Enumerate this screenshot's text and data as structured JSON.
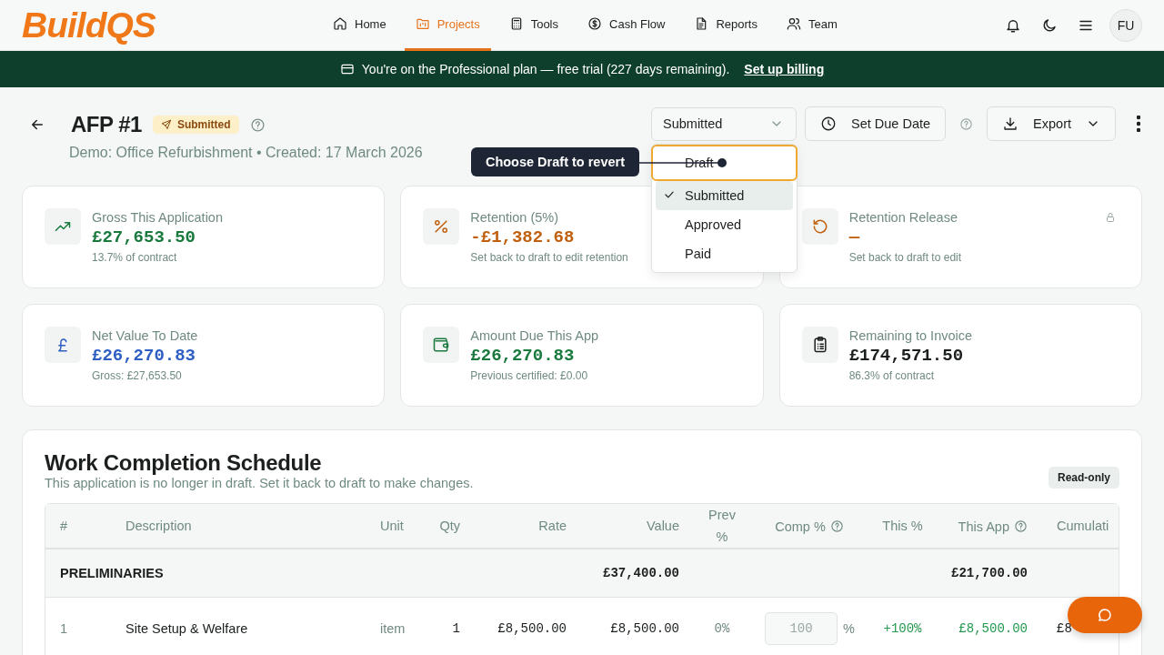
{
  "header": {
    "logo": "BuildQS",
    "nav": [
      {
        "label": "Home",
        "kind": "home",
        "selected": false
      },
      {
        "label": "Projects",
        "kind": "folder",
        "selected": true
      },
      {
        "label": "Tools",
        "kind": "calculator",
        "selected": false
      },
      {
        "label": "Cash Flow",
        "kind": "dollar",
        "selected": false
      },
      {
        "label": "Reports",
        "kind": "document",
        "selected": false
      },
      {
        "label": "Team",
        "kind": "people",
        "selected": false
      }
    ],
    "avatar": "FU"
  },
  "banner": {
    "text": "You're on the Professional plan — free trial (227 days remaining).",
    "link": "Set up billing"
  },
  "application": {
    "title": "AFP #1",
    "status_badge": "Submitted",
    "subtitle": "Demo: Office Refurbishment • Created: 17 March 2026",
    "status_select": {
      "value": "Submitted",
      "expanded": true,
      "options": [
        {
          "label": "Draft",
          "selected": false,
          "highlighted": true
        },
        {
          "label": "Submitted",
          "selected": true,
          "highlighted": false
        },
        {
          "label": "Approved",
          "selected": false,
          "highlighted": false
        },
        {
          "label": "Paid",
          "selected": false,
          "highlighted": false
        }
      ]
    },
    "tooltip": "Choose Draft to revert",
    "due_date_button": "Set Due Date",
    "export_button": "Export"
  },
  "cards": [
    {
      "kind": "trend",
      "label": "Gross This Application",
      "value": "£27,653.50",
      "note": "13.7% of contract",
      "color": "#1a7a3e",
      "locked": false
    },
    {
      "kind": "percent",
      "label": "Retention (5%)",
      "value": "-£1,382.68",
      "note": "Set back to draft to edit retention",
      "color": "#c0600f",
      "locked": false
    },
    {
      "kind": "undo",
      "label": "Retention Release",
      "value": "—",
      "note": "Set back to draft to edit",
      "color": "#c0600f",
      "locked": true
    },
    {
      "kind": "pound",
      "label": "Net Value To Date",
      "value": "£26,270.83",
      "note": "Gross: £27,653.50",
      "color": "#2f5fc4",
      "locked": false
    },
    {
      "kind": "wallet",
      "label": "Amount Due This App",
      "value": "£26,270.83",
      "note": "Previous certified: £0.00",
      "color": "#1a7a3e",
      "locked": false
    },
    {
      "kind": "clipboard",
      "label": "Remaining to Invoice",
      "value": "£174,571.50",
      "note": "86.3% of contract",
      "color": "#1b1f1d",
      "locked": false
    }
  ],
  "schedule": {
    "title": "Work Completion Schedule",
    "description": "This application is no longer in draft. Set it back to draft to make changes.",
    "badge": "Read-only",
    "columns": [
      {
        "label": "#",
        "help": false
      },
      {
        "label": "Description",
        "help": false
      },
      {
        "label": "Unit",
        "help": false
      },
      {
        "label": "Qty",
        "help": false
      },
      {
        "label": "Rate",
        "help": false
      },
      {
        "label": "Value",
        "help": false
      },
      {
        "label": "Prev %",
        "help": false
      },
      {
        "label": "Comp %",
        "help": true
      },
      {
        "label": "This %",
        "help": false
      },
      {
        "label": "This App",
        "help": true
      },
      {
        "label": "Cumulati",
        "help": false
      }
    ],
    "rows": [
      {
        "kind": "section",
        "name": "PRELIMINARIES",
        "value": "£37,400.00",
        "this_app": "£21,700.00"
      },
      {
        "kind": "item",
        "number": "1",
        "description": "Site Setup & Welfare",
        "unit": "item",
        "qty": "1",
        "rate": "£8,500.00",
        "value": "£8,500.00",
        "prev": "0%",
        "comp": "100",
        "comp_unit": "%",
        "disabled": true,
        "this_pct": "+100%",
        "this_app": "£8,500.00",
        "cumulative": "£8"
      }
    ]
  }
}
